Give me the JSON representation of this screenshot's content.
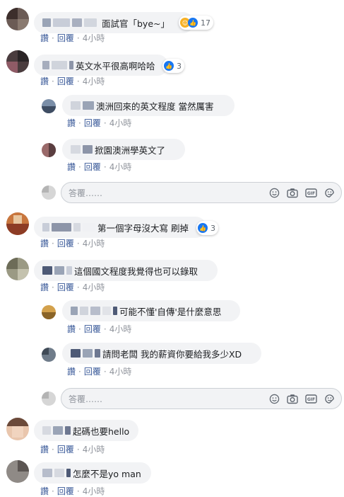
{
  "actions": {
    "like": "讚",
    "reply": "回覆",
    "separator": "·",
    "time": "4小時"
  },
  "reply_box": {
    "placeholder": "答覆……",
    "icons": [
      "smiley-icon",
      "camera-icon",
      "gif-icon",
      "sticker-icon"
    ]
  },
  "reaction_icons": {
    "like": "like-icon",
    "haha": "haha-icon"
  },
  "colors": {
    "like_blue": "#1877f2",
    "link": "#385898",
    "bubble": "#f2f3f5",
    "muted": "#90949c"
  },
  "comments": [
    {
      "text": "面試官「bye~」",
      "reaction_count": "17"
    },
    {
      "text": "英文水平很高啊哈哈",
      "reaction_count": "3",
      "replies": [
        {
          "text": "澳洲回來的英文程度 當然厲害"
        },
        {
          "text": "掀園澳洲學英文了"
        }
      ]
    },
    {
      "text": "第一個字母沒大寫 刷掉",
      "reaction_count": "3"
    },
    {
      "text": "這個國文程度我覺得也可以錄取",
      "replies": [
        {
          "text": "可能不懂'自傳'是什麼意思"
        },
        {
          "text": "請問老闆 我的薪資你要給我多少XD"
        }
      ]
    },
    {
      "text": "起碼也要hello"
    },
    {
      "text": "怎麼不是yo man"
    }
  ]
}
